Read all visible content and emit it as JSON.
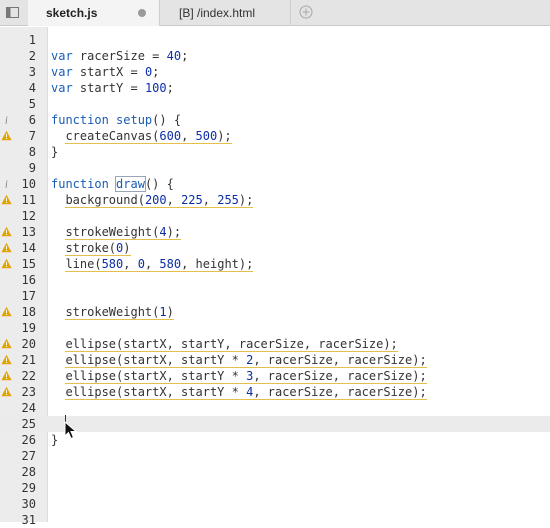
{
  "tabs": [
    {
      "label": "sketch.js",
      "active": true,
      "modified": true
    },
    {
      "label": "[B] /index.html",
      "active": false
    }
  ],
  "icons": {
    "sidebar": "sidebar-toggle-icon",
    "new_tab": "plus-circle-icon",
    "warning": "warning-icon",
    "info": "info-icon"
  },
  "colors": {
    "keyword": "#1a5cb4",
    "number": "#0c2ea8",
    "lint_underline": "#e3c04a",
    "warning": "#e0a400"
  },
  "lines": [
    {
      "n": "1",
      "text": ""
    },
    {
      "n": "2",
      "text": "var racerSize = 40;"
    },
    {
      "n": "3",
      "text": "var startX = 0;"
    },
    {
      "n": "4",
      "text": "var startY = 100;"
    },
    {
      "n": "5",
      "text": ""
    },
    {
      "n": "6",
      "text": "function setup() {",
      "marker": "info"
    },
    {
      "n": "7",
      "text": "  createCanvas(600, 500);",
      "marker": "warning"
    },
    {
      "n": "8",
      "text": "}"
    },
    {
      "n": "9",
      "text": ""
    },
    {
      "n": "10",
      "text": "function draw() {",
      "marker": "info"
    },
    {
      "n": "11",
      "text": "  background(200, 225, 255);",
      "marker": "warning"
    },
    {
      "n": "12",
      "text": ""
    },
    {
      "n": "13",
      "text": "  strokeWeight(4);",
      "marker": "warning"
    },
    {
      "n": "14",
      "text": "  stroke(0)",
      "marker": "warning"
    },
    {
      "n": "15",
      "text": "  line(580, 0, 580, height);",
      "marker": "warning"
    },
    {
      "n": "16",
      "text": ""
    },
    {
      "n": "17",
      "text": ""
    },
    {
      "n": "18",
      "text": "  strokeWeight(1)",
      "marker": "warning"
    },
    {
      "n": "19",
      "text": ""
    },
    {
      "n": "20",
      "text": "  ellipse(startX, startY, racerSize, racerSize);",
      "marker": "warning"
    },
    {
      "n": "21",
      "text": "  ellipse(startX, startY * 2, racerSize, racerSize);",
      "marker": "warning"
    },
    {
      "n": "22",
      "text": "  ellipse(startX, startY * 3, racerSize, racerSize);",
      "marker": "warning"
    },
    {
      "n": "23",
      "text": "  ellipse(startX, startY * 4, racerSize, racerSize);",
      "marker": "warning"
    },
    {
      "n": "24",
      "text": ""
    },
    {
      "n": "25",
      "text": "  ",
      "current": true
    },
    {
      "n": "26",
      "text": "}"
    },
    {
      "n": "27",
      "text": ""
    },
    {
      "n": "28",
      "text": ""
    },
    {
      "n": "29",
      "text": ""
    },
    {
      "n": "30",
      "text": ""
    },
    {
      "n": "31",
      "text": ""
    }
  ]
}
